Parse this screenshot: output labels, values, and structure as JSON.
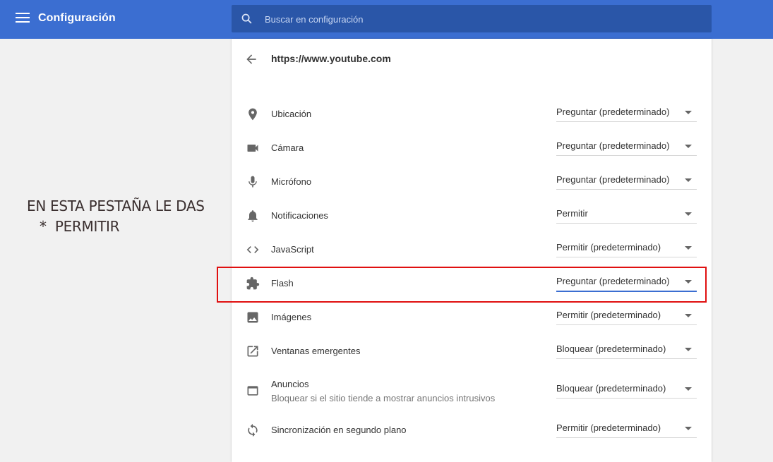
{
  "header": {
    "title": "Configuración",
    "search_placeholder": "Buscar en configuración",
    "accent_color": "#3b6ed1"
  },
  "annotation": {
    "line1": "EN ESTA PESTAÑA LE DAS",
    "line2": "*  PERMITIR",
    "highlight_color": "#e01010"
  },
  "site": {
    "url": "https://www.youtube.com"
  },
  "permissions": [
    {
      "icon": "location-pin-icon",
      "label": "Ubicación",
      "value": "Preguntar (predeterminado)"
    },
    {
      "icon": "video-camera-icon",
      "label": "Cámara",
      "value": "Preguntar (predeterminado)"
    },
    {
      "icon": "microphone-icon",
      "label": "Micrófono",
      "value": "Preguntar (predeterminado)"
    },
    {
      "icon": "bell-icon",
      "label": "Notificaciones",
      "value": "Permitir"
    },
    {
      "icon": "code-brackets-icon",
      "label": "JavaScript",
      "value": "Permitir (predeterminado)"
    },
    {
      "icon": "puzzle-piece-icon",
      "label": "Flash",
      "value": "Preguntar (predeterminado)"
    },
    {
      "icon": "image-icon",
      "label": "Imágenes",
      "value": "Permitir (predeterminado)"
    },
    {
      "icon": "open-in-new-icon",
      "label": "Ventanas emergentes",
      "value": "Bloquear (predeterminado)"
    },
    {
      "icon": "browser-window-icon",
      "label": "Anuncios",
      "sub": "Bloquear si el sitio tiende a mostrar anuncios intrusivos",
      "value": "Bloquear (predeterminado)"
    },
    {
      "icon": "sync-icon",
      "label": "Sincronización en segundo plano",
      "value": "Permitir (predeterminado)"
    }
  ]
}
